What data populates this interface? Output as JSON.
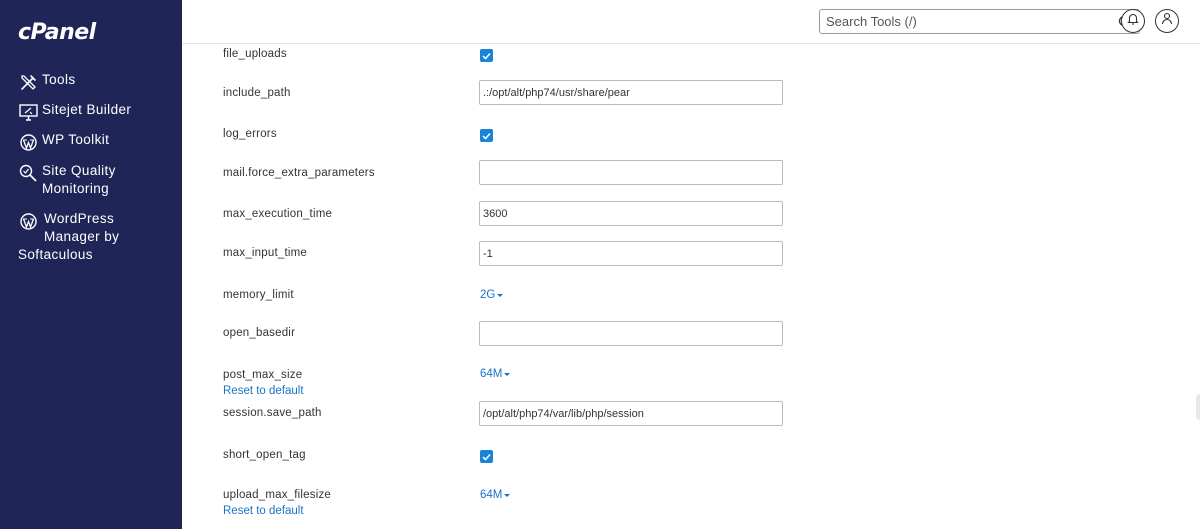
{
  "sidebar": {
    "logo": "cPanel",
    "items": [
      {
        "label": "Tools",
        "icon": "tools-icon"
      },
      {
        "label": "Sitejet Builder",
        "icon": "monitor-icon"
      },
      {
        "label": "WP Toolkit",
        "icon": "wordpress-icon"
      },
      {
        "label": "Site Quality Monitoring",
        "icon": "quality-search-icon"
      },
      {
        "label_lines": [
          "WordPress",
          "Manager by",
          "Softaculous"
        ],
        "icon": "wordpress-icon"
      }
    ]
  },
  "header": {
    "search_placeholder": "Search Tools (/)"
  },
  "settings": [
    {
      "name": "file_uploads",
      "type": "checkbox",
      "checked": true
    },
    {
      "name": "include_path",
      "type": "text",
      "value": ".:/opt/alt/php74/usr/share/pear"
    },
    {
      "name": "log_errors",
      "type": "checkbox",
      "checked": true
    },
    {
      "name": "mail.force_extra_parameters",
      "type": "text",
      "value": ""
    },
    {
      "name": "max_execution_time",
      "type": "text",
      "value": "3600"
    },
    {
      "name": "max_input_time",
      "type": "text",
      "value": "-1"
    },
    {
      "name": "memory_limit",
      "type": "select",
      "value": "2G"
    },
    {
      "name": "open_basedir",
      "type": "text",
      "value": ""
    },
    {
      "name": "post_max_size",
      "type": "select",
      "value": "64M",
      "reset": "Reset to default"
    },
    {
      "name": "session.save_path",
      "type": "text",
      "value": "/opt/alt/php74/var/lib/php/session"
    },
    {
      "name": "short_open_tag",
      "type": "checkbox",
      "checked": true
    },
    {
      "name": "upload_max_filesize",
      "type": "select",
      "value": "64M",
      "reset": "Reset to default"
    }
  ],
  "colors": {
    "sidebar_bg": "#1f2657",
    "accent": "#1a82d9",
    "link": "#1a73c6"
  }
}
